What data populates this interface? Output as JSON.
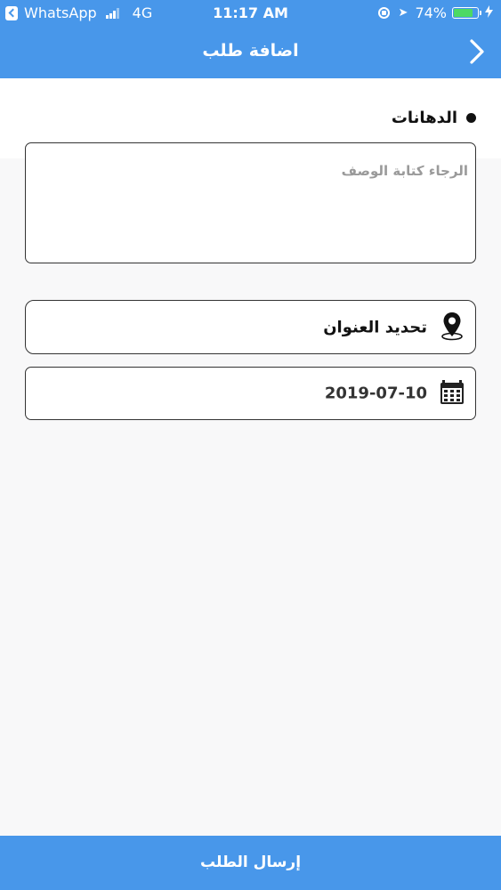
{
  "status_bar": {
    "back_app": "WhatsApp",
    "network": "4G",
    "time": "11:17 AM",
    "battery": "74%"
  },
  "header": {
    "title": "اضافة طلب"
  },
  "section": {
    "label": "الدهانات"
  },
  "description": {
    "placeholder": "الرجاء كتابة الوصف",
    "value": ""
  },
  "address": {
    "label": "تحديد العنوان"
  },
  "date": {
    "value": "2019-07-10"
  },
  "footer": {
    "submit_label": "إرسال الطلب"
  },
  "colors": {
    "primary": "#4897ea",
    "battery_fill": "#4cd964",
    "text": "#111111",
    "placeholder": "#9a9a9a"
  },
  "icons": {
    "back": "chevron-right-icon",
    "address": "map-pin-icon",
    "date": "calendar-icon"
  }
}
